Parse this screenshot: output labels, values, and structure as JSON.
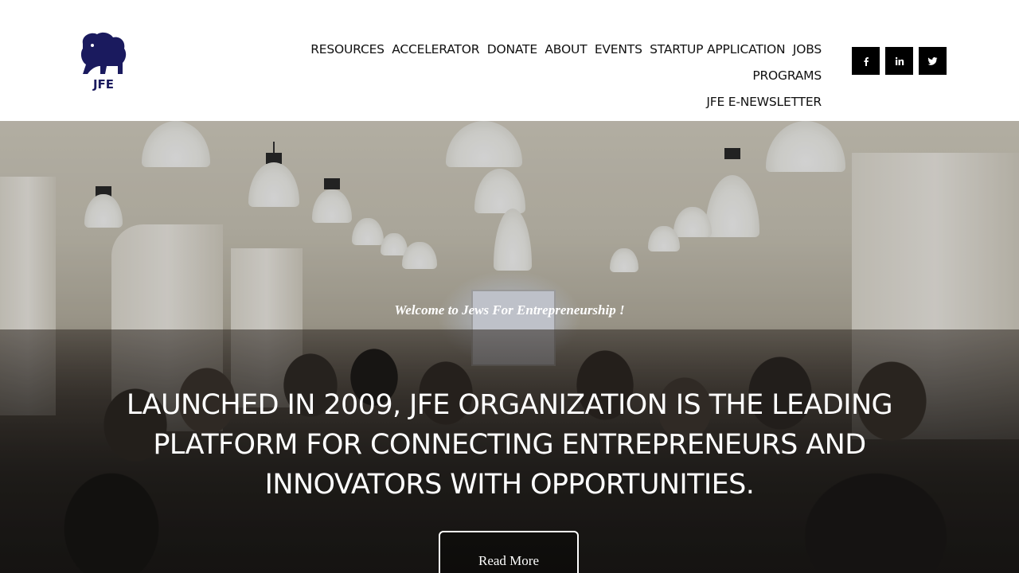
{
  "header": {
    "logo_text": "JFE",
    "nav": [
      {
        "label": "Resources"
      },
      {
        "label": "Accelerator"
      },
      {
        "label": "Donate"
      },
      {
        "label": "About"
      },
      {
        "label": "Events"
      },
      {
        "label": "Startup Application"
      },
      {
        "label": "Jobs"
      },
      {
        "label": "Programs"
      },
      {
        "label": "JFE e-Newsletter"
      }
    ],
    "social": [
      {
        "icon": "facebook-icon",
        "glyph": "f"
      },
      {
        "icon": "linkedin-icon",
        "glyph": "in"
      },
      {
        "icon": "twitter-icon",
        "glyph": ""
      }
    ]
  },
  "hero": {
    "welcome": "Welcome to Jews For Entrepreneurship !",
    "headline": "Launched in 2009, JFE Organization is the leading platform for connecting  entrepreneurs and innovators with opportunities.",
    "button_label": "Read More"
  },
  "colors": {
    "logo_navy": "#1a1a5e",
    "social_bg": "#000000",
    "text_white": "#ffffff"
  }
}
